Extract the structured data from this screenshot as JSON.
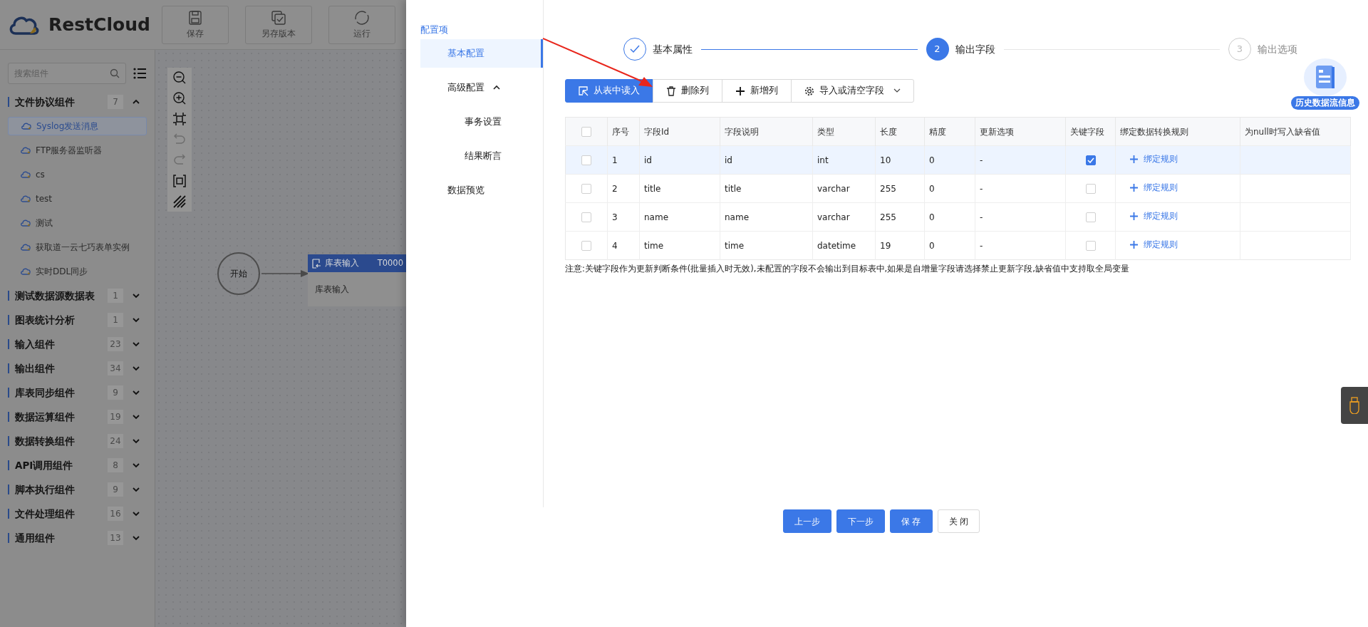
{
  "app": {
    "logo": "RestCloud",
    "toolbar": [
      {
        "label": "保存"
      },
      {
        "label": "另存版本"
      },
      {
        "label": "运行"
      }
    ],
    "sidebar": {
      "search": {
        "placeholder": "搜索组件"
      },
      "groups": [
        {
          "name": "文件协议组件",
          "count": "7",
          "expanded": true,
          "items": [
            {
              "label": "Syslog发送消息",
              "selected": true
            },
            {
              "label": "FTP服务器监听器",
              "selected": false
            },
            {
              "label": "cs",
              "selected": false
            },
            {
              "label": "test",
              "selected": false
            },
            {
              "label": "测试",
              "selected": false
            },
            {
              "label": "获取道一云七巧表单实例",
              "selected": false
            },
            {
              "label": "实时DDL同步",
              "selected": false
            }
          ]
        },
        {
          "name": "测试数据源数据表",
          "count": "1",
          "expanded": false
        },
        {
          "name": "图表统计分析",
          "count": "1",
          "expanded": false
        },
        {
          "name": "输入组件",
          "count": "23",
          "expanded": false
        },
        {
          "name": "输出组件",
          "count": "34",
          "expanded": false
        },
        {
          "name": "库表同步组件",
          "count": "9",
          "expanded": false
        },
        {
          "name": "数据运算组件",
          "count": "19",
          "expanded": false
        },
        {
          "name": "数据转换组件",
          "count": "24",
          "expanded": false
        },
        {
          "name": "API调用组件",
          "count": "8",
          "expanded": false
        },
        {
          "name": "脚本执行组件",
          "count": "9",
          "expanded": false
        },
        {
          "name": "文件处理组件",
          "count": "16",
          "expanded": false
        },
        {
          "name": "通用组件",
          "count": "13",
          "expanded": false
        }
      ]
    },
    "canvas": {
      "start": "开始",
      "node": {
        "title": "库表输入",
        "code": "T0000",
        "body": "库表输入"
      }
    }
  },
  "drawer": {
    "nav_title": "配置项",
    "nav": [
      {
        "label": "基本配置",
        "selected": true
      },
      {
        "label": "高级配置",
        "selected": false,
        "expanded": true,
        "children": [
          {
            "label": "事务设置",
            "selected": false
          },
          {
            "label": "结果断言",
            "selected": false
          }
        ]
      },
      {
        "label": "数据预览",
        "selected": false
      }
    ],
    "steps": [
      {
        "label": "基本属性",
        "completed": true,
        "active": false
      },
      {
        "number": "2",
        "label": "输出字段",
        "completed": false,
        "active": true
      },
      {
        "number": "3",
        "label": "输出选项",
        "completed": false,
        "active": false
      }
    ],
    "actions": [
      {
        "label": "从表中读入",
        "primary": true
      },
      {
        "label": "删除列",
        "primary": false
      },
      {
        "label": "新增列",
        "primary": false
      },
      {
        "label": "导入或清空字段",
        "primary": false,
        "dropdown": true
      }
    ],
    "history_badge": "历史数据流信息",
    "table": {
      "select_all": {
        "checked": false
      },
      "columns": [
        "序号",
        "字段Id",
        "字段说明",
        "类型",
        "长度",
        "精度",
        "更新选项",
        "关键字段",
        "绑定数据转换规则",
        "为null时写入缺省值"
      ],
      "rows": [
        {
          "selected": true,
          "checked": false,
          "cells": [
            "1",
            "id",
            "id",
            "int",
            "10",
            "0",
            "-"
          ],
          "key": true,
          "rule": "绑定规则"
        },
        {
          "selected": false,
          "checked": false,
          "cells": [
            "2",
            "title",
            "title",
            "varchar",
            "255",
            "0",
            "-"
          ],
          "key": false,
          "rule": "绑定规则"
        },
        {
          "selected": false,
          "checked": false,
          "cells": [
            "3",
            "name",
            "name",
            "varchar",
            "255",
            "0",
            "-"
          ],
          "key": false,
          "rule": "绑定规则"
        },
        {
          "selected": false,
          "checked": false,
          "cells": [
            "4",
            "time",
            "time",
            "datetime",
            "19",
            "0",
            "-"
          ],
          "key": false,
          "rule": "绑定规则"
        }
      ]
    },
    "note": "注意:关键字段作为更新判断条件(批量插入时无效),未配置的字段不会输出到目标表中,如果是自增量字段请选择禁止更新字段,缺省值中支持取全局变量",
    "footer": [
      {
        "label": "上一步",
        "primary": true
      },
      {
        "label": "下一步",
        "primary": true
      },
      {
        "label": "保 存",
        "primary": true
      },
      {
        "label": "关 闭",
        "primary": false
      }
    ]
  }
}
